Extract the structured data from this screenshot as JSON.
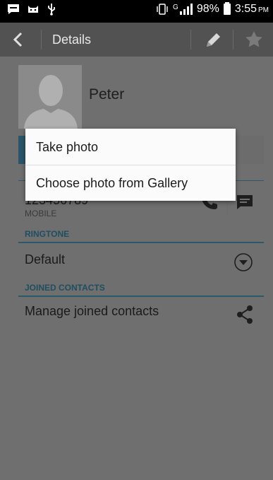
{
  "status_bar": {
    "battery": "98%",
    "time": "3:55",
    "ampm": "PM",
    "network": "G"
  },
  "app_bar": {
    "title": "Details"
  },
  "contact": {
    "name": "Peter",
    "phone_number": "123456789",
    "phone_type": "MOBILE"
  },
  "sections": {
    "ringtone_header": "RINGTONE",
    "ringtone_value": "Default",
    "joined_header": "JOINED CONTACTS",
    "joined_action": "Manage joined contacts"
  },
  "popup": {
    "items": [
      {
        "label": "Take photo"
      },
      {
        "label": "Choose photo from Gallery"
      }
    ]
  },
  "colors": {
    "accent": "#2b586b",
    "popup_bg": "#fbfbfb",
    "overlay_bg": "#6f6f6f"
  }
}
